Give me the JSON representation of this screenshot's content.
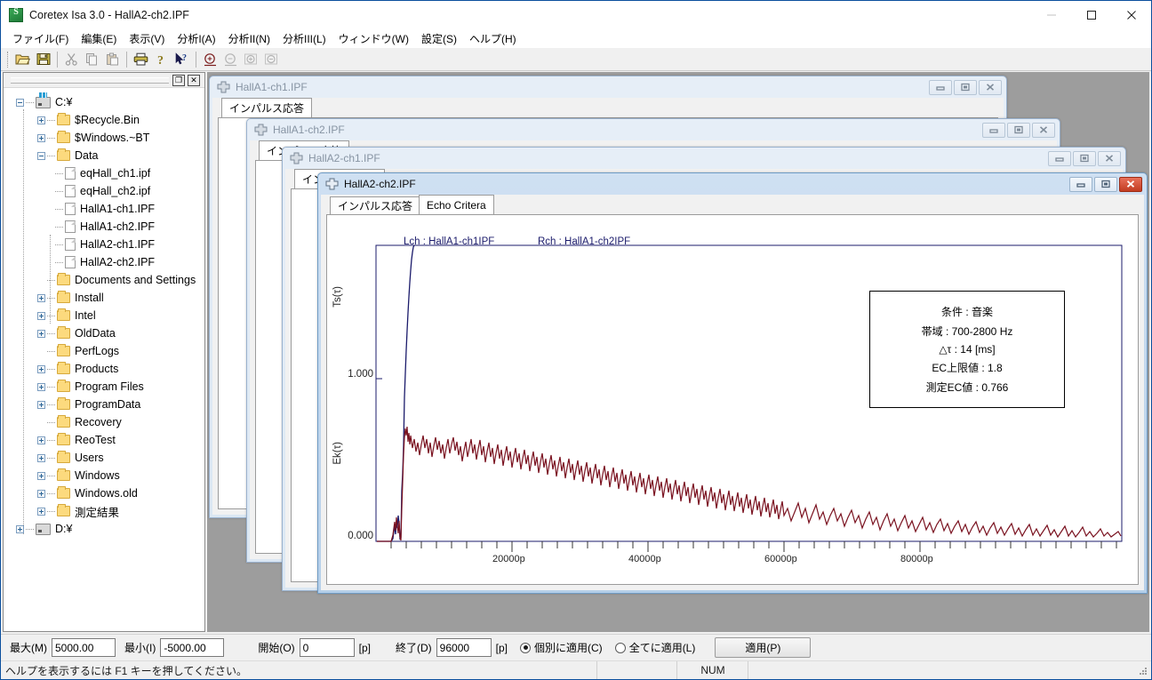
{
  "window": {
    "title": "Coretex Isa 3.0 - HallA2-ch2.IPF",
    "icon": "app-icon",
    "minimize": "minimize-icon",
    "maximize": "maximize-icon",
    "close": "close-icon"
  },
  "menu": [
    {
      "label": "ファイル(F)"
    },
    {
      "label": "編集(E)"
    },
    {
      "label": "表示(V)"
    },
    {
      "label": "分析I(A)"
    },
    {
      "label": "分析II(N)"
    },
    {
      "label": "分析III(L)"
    },
    {
      "label": "ウィンドウ(W)"
    },
    {
      "label": "設定(S)"
    },
    {
      "label": "ヘルプ(H)"
    }
  ],
  "toolbar": {
    "buttons": [
      {
        "name": "open-icon",
        "enabled": true
      },
      {
        "name": "save-icon",
        "enabled": true
      },
      {
        "name": "cut-icon",
        "enabled": false
      },
      {
        "name": "copy-icon",
        "enabled": false
      },
      {
        "name": "paste-icon",
        "enabled": false
      },
      {
        "name": "print-icon",
        "enabled": true
      },
      {
        "name": "about-icon",
        "enabled": true
      },
      {
        "name": "help-cursor-icon",
        "enabled": true
      },
      {
        "name": "zoom-region-icon",
        "enabled": true
      },
      {
        "name": "zoom-reset-icon",
        "enabled": false
      },
      {
        "name": "zoom-in-icon",
        "enabled": false
      },
      {
        "name": "zoom-out-icon",
        "enabled": false
      }
    ]
  },
  "tree_panel": {
    "restore_label": "❐",
    "close_label": "✕",
    "items": [
      {
        "label": "C:¥",
        "indent": 0,
        "icon": "drive",
        "state": "minus"
      },
      {
        "label": "$Recycle.Bin",
        "indent": 1,
        "icon": "folder",
        "state": "plus"
      },
      {
        "label": "$Windows.~BT",
        "indent": 1,
        "icon": "folder",
        "state": "plus"
      },
      {
        "label": "Data",
        "indent": 1,
        "icon": "folder",
        "state": "minus"
      },
      {
        "label": "eqHall_ch1.ipf",
        "indent": 2,
        "icon": "file",
        "state": "none"
      },
      {
        "label": "eqHall_ch2.ipf",
        "indent": 2,
        "icon": "file",
        "state": "none"
      },
      {
        "label": "HallA1-ch1.IPF",
        "indent": 2,
        "icon": "file",
        "state": "none"
      },
      {
        "label": "HallA1-ch2.IPF",
        "indent": 2,
        "icon": "file",
        "state": "none"
      },
      {
        "label": "HallA2-ch1.IPF",
        "indent": 2,
        "icon": "file",
        "state": "none"
      },
      {
        "label": "HallA2-ch2.IPF",
        "indent": 2,
        "icon": "file",
        "state": "none"
      },
      {
        "label": "Documents and Settings",
        "indent": 1,
        "icon": "folder",
        "state": "none"
      },
      {
        "label": "Install",
        "indent": 1,
        "icon": "folder",
        "state": "plus"
      },
      {
        "label": "Intel",
        "indent": 1,
        "icon": "folder",
        "state": "plus"
      },
      {
        "label": "OldData",
        "indent": 1,
        "icon": "folder",
        "state": "plus"
      },
      {
        "label": "PerfLogs",
        "indent": 1,
        "icon": "folder",
        "state": "none"
      },
      {
        "label": "Products",
        "indent": 1,
        "icon": "folder",
        "state": "plus"
      },
      {
        "label": "Program Files",
        "indent": 1,
        "icon": "folder",
        "state": "plus"
      },
      {
        "label": "ProgramData",
        "indent": 1,
        "icon": "folder",
        "state": "plus"
      },
      {
        "label": "Recovery",
        "indent": 1,
        "icon": "folder",
        "state": "none"
      },
      {
        "label": "ReoTest",
        "indent": 1,
        "icon": "folder",
        "state": "plus"
      },
      {
        "label": "Users",
        "indent": 1,
        "icon": "folder",
        "state": "plus"
      },
      {
        "label": "Windows",
        "indent": 1,
        "icon": "folder",
        "state": "plus"
      },
      {
        "label": "Windows.old",
        "indent": 1,
        "icon": "folder",
        "state": "plus"
      },
      {
        "label": "測定結果",
        "indent": 1,
        "icon": "folder",
        "state": "plus"
      },
      {
        "label": "D:¥",
        "indent": 0,
        "icon": "drive",
        "state": "plus"
      }
    ]
  },
  "mdi_windows": [
    {
      "title": "HallA1-ch1.IPF",
      "active": false,
      "tab": "インパルス応答"
    },
    {
      "title": "HallA1-ch2.IPF",
      "active": false,
      "tab": "インパルス応答"
    },
    {
      "title": "HallA2-ch1.IPF",
      "active": false,
      "tab": "インパルス応答"
    },
    {
      "title": "HallA2-ch2.IPF",
      "active": true,
      "tab": "インパルス応答"
    }
  ],
  "active_window": {
    "title": "HallA2-ch2.IPF",
    "tabs": [
      {
        "label": "インパルス応答",
        "selected": false
      },
      {
        "label": "Echo Critera",
        "selected": true
      }
    ],
    "buttons": {
      "minimize": "minimize-icon",
      "maximize": "maximize-icon",
      "close": "close-icon"
    }
  },
  "chart_data": {
    "type": "line",
    "title": "",
    "legend": [
      {
        "label": "Lch : HallA1-ch1IPF",
        "color": "#1b1b6b"
      },
      {
        "label": "Rch : HallA1-ch2IPF",
        "color": "#1b1b6b"
      }
    ],
    "ylabel_top": "Ts(τ)",
    "ylabel_bottom": "Ek(τ)",
    "ytick_labels": [
      "1.000",
      "0.000"
    ],
    "ytick_values": [
      1.0,
      0.0
    ],
    "ylim": [
      0.0,
      2.2
    ],
    "xlabel": "",
    "xtick_labels": [
      "20000p",
      "40000p",
      "60000p",
      "80000p"
    ],
    "xtick_values": [
      20000,
      40000,
      60000,
      80000
    ],
    "xlim": [
      0,
      96000
    ],
    "grid": false,
    "legend_position": "top",
    "series": [
      {
        "name": "Lch : HallA1-ch1IPF",
        "color": "#1b1b6b",
        "comment": "Ts(tau) running integral: flat at 0 until onset ~3000p, then steep near-vertical rise off the top of the plot",
        "x": [
          0,
          2300,
          2700,
          2900,
          3050,
          3100,
          3150,
          3250,
          3400,
          3700,
          4200,
          5000,
          6200,
          7600,
          9200
        ],
        "y": [
          0.0,
          0.0,
          0.02,
          0.1,
          0.28,
          0.17,
          0.35,
          0.62,
          0.95,
          1.3,
          1.62,
          1.9,
          2.08,
          2.16,
          2.2
        ]
      },
      {
        "name": "Rch : HallA1-ch2IPF",
        "color": "#7a1220",
        "comment": "Ek(tau) echo criterion: sharp peak just after onset then noisy exponential decay toward 0",
        "x": [
          0,
          2500,
          2800,
          2950,
          3050,
          3150,
          3300,
          3600,
          4200,
          5000,
          6000,
          7000,
          8000,
          9500,
          11000,
          13000,
          15000,
          18000,
          21000,
          24000,
          27000,
          30000,
          34000,
          38000,
          42000,
          46000,
          50000,
          55000,
          60000,
          66000,
          72000,
          78000,
          84000,
          90000,
          96000
        ],
        "y": [
          0.0,
          0.0,
          0.09,
          0.05,
          0.14,
          0.03,
          0.7,
          0.52,
          0.46,
          0.42,
          0.5,
          0.36,
          0.44,
          0.31,
          0.39,
          0.34,
          0.3,
          0.33,
          0.26,
          0.31,
          0.24,
          0.28,
          0.21,
          0.24,
          0.19,
          0.2,
          0.16,
          0.15,
          0.12,
          0.1,
          0.08,
          0.06,
          0.05,
          0.04,
          0.03
        ]
      }
    ],
    "annotation_box": {
      "lines": [
        "条件 : 音楽",
        "帯域 : 700-2800 Hz",
        "△τ : 14 [ms]",
        "EC上限値 : 1.8",
        "測定EC値 : 0.766"
      ]
    }
  },
  "control_bar": {
    "max_label": "最大(M)",
    "max_value": "5000.00",
    "min_label": "最小(I)",
    "min_value": "-5000.00",
    "start_label": "開始(O)",
    "start_value": "0",
    "start_unit": "[p]",
    "end_label": "終了(D)",
    "end_value": "96000",
    "end_unit": "[p]",
    "radio_individual": "個別に適用(C)",
    "radio_all": "全てに適用(L)",
    "apply_label": "適用(P)"
  },
  "status_bar": {
    "hint": "ヘルプを表示するには F1 キーを押してください。",
    "num_indicator": "NUM"
  },
  "colors": {
    "accent": "#0b4f9e",
    "mdi_background": "#9d9d9d",
    "active_close": "#c23c22",
    "series_lch": "#1b1b6b",
    "series_rch": "#7a1220"
  }
}
